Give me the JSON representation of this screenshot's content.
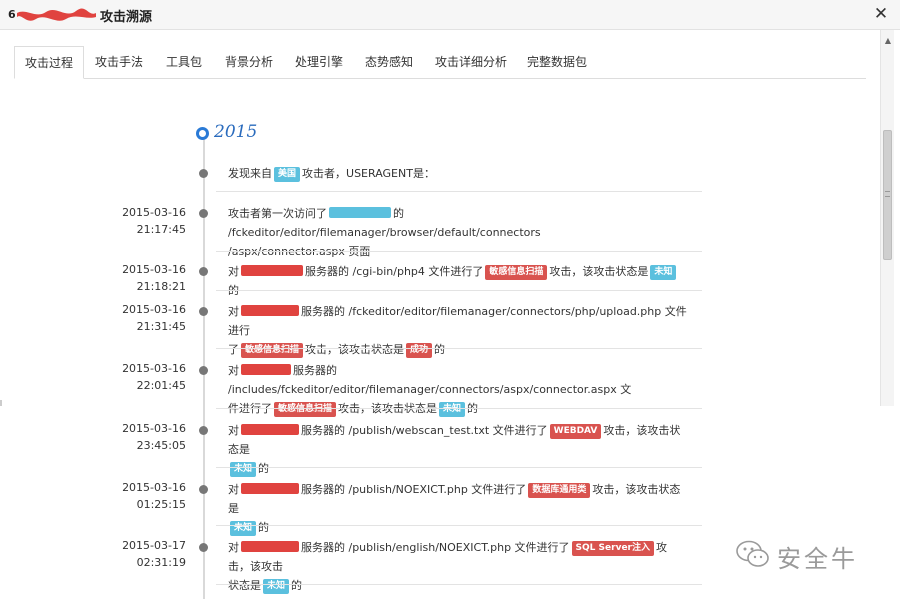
{
  "window": {
    "title": "攻击溯源",
    "close_label": "✕"
  },
  "tabs": [
    {
      "label": "攻击过程",
      "active": true
    },
    {
      "label": "攻击手法",
      "active": false
    },
    {
      "label": "工具包",
      "active": false
    },
    {
      "label": "背景分析",
      "active": false
    },
    {
      "label": "处理引擎",
      "active": false
    },
    {
      "label": "态势感知",
      "active": false
    },
    {
      "label": "攻击详细分析",
      "active": false
    },
    {
      "label": "完整数据包",
      "active": false
    }
  ],
  "timeline": {
    "year": "2015",
    "events": [
      {
        "date": "",
        "time": "",
        "parts": [
          "发现来自",
          "美国",
          "攻击者，USERAGENT是："
        ]
      },
      {
        "date": "2015-03-16",
        "time": "21:17:45",
        "parts": [
          "攻击者第一次访问了",
          "的 /fckeditor/editor/filemanager/browser/default/connectors",
          "/aspx/connector.aspx 页面"
        ]
      },
      {
        "date": "2015-03-16",
        "time": "21:18:21",
        "parts": [
          "对",
          "服务器的 /cgi-bin/php4 文件进行了",
          "敏感信息扫描",
          "攻击，该攻击状态是",
          "未知",
          "的"
        ]
      },
      {
        "date": "2015-03-16",
        "time": "21:31:45",
        "parts": [
          "对",
          "服务器的 /fckeditor/editor/filemanager/connectors/php/upload.php 文件进行",
          "了",
          "敏感信息扫描",
          "攻击，该攻击状态是",
          "成功",
          "的"
        ]
      },
      {
        "date": "2015-03-16",
        "time": "22:01:45",
        "parts": [
          "对",
          "服务器的 /includes/fckeditor/editor/filemanager/connectors/aspx/connector.aspx 文",
          "件进行了",
          "敏感信息扫描",
          "攻击，该攻击状态是",
          "未知",
          "的"
        ]
      },
      {
        "date": "2015-03-16",
        "time": "23:45:05",
        "parts": [
          "对",
          "服务器的 /publish/webscan_test.txt 文件进行了",
          "WEBDAV",
          "攻击，该攻击状态是",
          "未知",
          "的"
        ]
      },
      {
        "date": "2015-03-16",
        "time": "01:25:15",
        "parts": [
          "对",
          "服务器的 /publish/NOEXICT.php 文件进行了",
          "数据库通用类",
          "攻击，该攻击状态是",
          "未知",
          "的"
        ]
      },
      {
        "date": "2015-03-17",
        "time": "02:31:19",
        "parts": [
          "对",
          "服务器的 /publish/english/NOEXICT.php 文件进行了",
          "SQL Server注入",
          "攻击，该攻击",
          "状态是",
          "未知",
          "的"
        ]
      }
    ]
  },
  "watermark": {
    "text": "安全牛",
    "icon": "wechat-icon"
  },
  "colors": {
    "accent": "#2a7ad6",
    "badge_red": "#d9534f",
    "badge_blue": "#5bc0de",
    "redact_red": "#e0433f"
  }
}
